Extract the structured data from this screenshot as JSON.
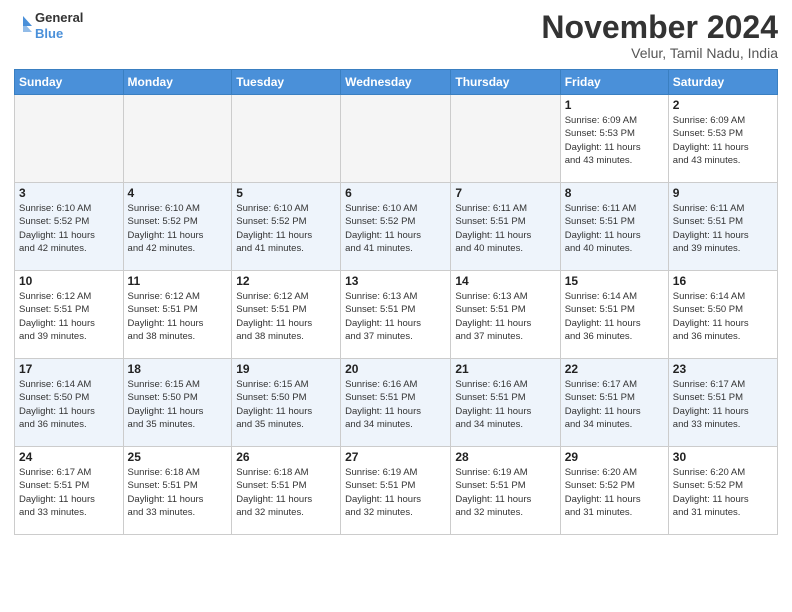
{
  "logo": {
    "line1": "General",
    "line2": "Blue"
  },
  "title": "November 2024",
  "location": "Velur, Tamil Nadu, India",
  "weekdays": [
    "Sunday",
    "Monday",
    "Tuesday",
    "Wednesday",
    "Thursday",
    "Friday",
    "Saturday"
  ],
  "weeks": [
    [
      {
        "day": "",
        "info": ""
      },
      {
        "day": "",
        "info": ""
      },
      {
        "day": "",
        "info": ""
      },
      {
        "day": "",
        "info": ""
      },
      {
        "day": "",
        "info": ""
      },
      {
        "day": "1",
        "info": "Sunrise: 6:09 AM\nSunset: 5:53 PM\nDaylight: 11 hours\nand 43 minutes."
      },
      {
        "day": "2",
        "info": "Sunrise: 6:09 AM\nSunset: 5:53 PM\nDaylight: 11 hours\nand 43 minutes."
      }
    ],
    [
      {
        "day": "3",
        "info": "Sunrise: 6:10 AM\nSunset: 5:52 PM\nDaylight: 11 hours\nand 42 minutes."
      },
      {
        "day": "4",
        "info": "Sunrise: 6:10 AM\nSunset: 5:52 PM\nDaylight: 11 hours\nand 42 minutes."
      },
      {
        "day": "5",
        "info": "Sunrise: 6:10 AM\nSunset: 5:52 PM\nDaylight: 11 hours\nand 41 minutes."
      },
      {
        "day": "6",
        "info": "Sunrise: 6:10 AM\nSunset: 5:52 PM\nDaylight: 11 hours\nand 41 minutes."
      },
      {
        "day": "7",
        "info": "Sunrise: 6:11 AM\nSunset: 5:51 PM\nDaylight: 11 hours\nand 40 minutes."
      },
      {
        "day": "8",
        "info": "Sunrise: 6:11 AM\nSunset: 5:51 PM\nDaylight: 11 hours\nand 40 minutes."
      },
      {
        "day": "9",
        "info": "Sunrise: 6:11 AM\nSunset: 5:51 PM\nDaylight: 11 hours\nand 39 minutes."
      }
    ],
    [
      {
        "day": "10",
        "info": "Sunrise: 6:12 AM\nSunset: 5:51 PM\nDaylight: 11 hours\nand 39 minutes."
      },
      {
        "day": "11",
        "info": "Sunrise: 6:12 AM\nSunset: 5:51 PM\nDaylight: 11 hours\nand 38 minutes."
      },
      {
        "day": "12",
        "info": "Sunrise: 6:12 AM\nSunset: 5:51 PM\nDaylight: 11 hours\nand 38 minutes."
      },
      {
        "day": "13",
        "info": "Sunrise: 6:13 AM\nSunset: 5:51 PM\nDaylight: 11 hours\nand 37 minutes."
      },
      {
        "day": "14",
        "info": "Sunrise: 6:13 AM\nSunset: 5:51 PM\nDaylight: 11 hours\nand 37 minutes."
      },
      {
        "day": "15",
        "info": "Sunrise: 6:14 AM\nSunset: 5:51 PM\nDaylight: 11 hours\nand 36 minutes."
      },
      {
        "day": "16",
        "info": "Sunrise: 6:14 AM\nSunset: 5:50 PM\nDaylight: 11 hours\nand 36 minutes."
      }
    ],
    [
      {
        "day": "17",
        "info": "Sunrise: 6:14 AM\nSunset: 5:50 PM\nDaylight: 11 hours\nand 36 minutes."
      },
      {
        "day": "18",
        "info": "Sunrise: 6:15 AM\nSunset: 5:50 PM\nDaylight: 11 hours\nand 35 minutes."
      },
      {
        "day": "19",
        "info": "Sunrise: 6:15 AM\nSunset: 5:50 PM\nDaylight: 11 hours\nand 35 minutes."
      },
      {
        "day": "20",
        "info": "Sunrise: 6:16 AM\nSunset: 5:51 PM\nDaylight: 11 hours\nand 34 minutes."
      },
      {
        "day": "21",
        "info": "Sunrise: 6:16 AM\nSunset: 5:51 PM\nDaylight: 11 hours\nand 34 minutes."
      },
      {
        "day": "22",
        "info": "Sunrise: 6:17 AM\nSunset: 5:51 PM\nDaylight: 11 hours\nand 34 minutes."
      },
      {
        "day": "23",
        "info": "Sunrise: 6:17 AM\nSunset: 5:51 PM\nDaylight: 11 hours\nand 33 minutes."
      }
    ],
    [
      {
        "day": "24",
        "info": "Sunrise: 6:17 AM\nSunset: 5:51 PM\nDaylight: 11 hours\nand 33 minutes."
      },
      {
        "day": "25",
        "info": "Sunrise: 6:18 AM\nSunset: 5:51 PM\nDaylight: 11 hours\nand 33 minutes."
      },
      {
        "day": "26",
        "info": "Sunrise: 6:18 AM\nSunset: 5:51 PM\nDaylight: 11 hours\nand 32 minutes."
      },
      {
        "day": "27",
        "info": "Sunrise: 6:19 AM\nSunset: 5:51 PM\nDaylight: 11 hours\nand 32 minutes."
      },
      {
        "day": "28",
        "info": "Sunrise: 6:19 AM\nSunset: 5:51 PM\nDaylight: 11 hours\nand 32 minutes."
      },
      {
        "day": "29",
        "info": "Sunrise: 6:20 AM\nSunset: 5:52 PM\nDaylight: 11 hours\nand 31 minutes."
      },
      {
        "day": "30",
        "info": "Sunrise: 6:20 AM\nSunset: 5:52 PM\nDaylight: 11 hours\nand 31 minutes."
      }
    ]
  ]
}
